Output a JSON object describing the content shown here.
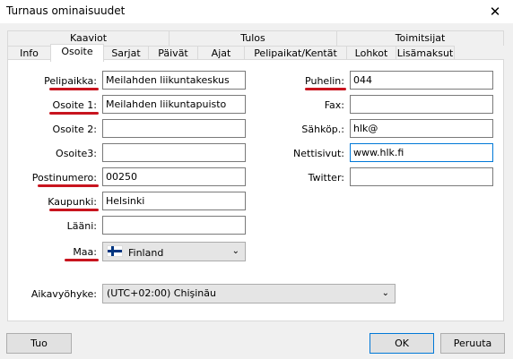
{
  "window": {
    "title": "Turnaus ominaisuudet",
    "close_glyph": "✕"
  },
  "tabs_upper": [
    "Kaaviot",
    "Tulos",
    "Toimitsijat"
  ],
  "tabs_lower": [
    "Info",
    "Osoite",
    "Sarjat",
    "Päivät",
    "Ajat",
    "Pelipaikat/Kentät",
    "Lohkot",
    "Lisämaksut"
  ],
  "active_tab": "Osoite",
  "left_fields": [
    {
      "label": "Pelipaikka:",
      "value": "Meilahden liikuntakeskus",
      "underlined": true
    },
    {
      "label": "Osoite 1:",
      "value": "Meilahden liikuntapuisto",
      "underlined": true
    },
    {
      "label": "Osoite 2:",
      "value": "",
      "underlined": false
    },
    {
      "label": "Osoite3:",
      "value": "",
      "underlined": false
    },
    {
      "label": "Postinumero:",
      "value": "00250",
      "underlined": true
    },
    {
      "label": "Kaupunki:",
      "value": "Helsinki",
      "underlined": true
    },
    {
      "label": "Lääni:",
      "value": "",
      "underlined": false
    }
  ],
  "country": {
    "label": "Maa:",
    "value": "Finland",
    "flag_icon": "finland-flag-icon",
    "underlined": true
  },
  "right_fields": [
    {
      "label": "Puhelin:",
      "value": "044",
      "underlined": true
    },
    {
      "label": "Fax:",
      "value": "",
      "underlined": false
    },
    {
      "label": "Sähköp.:",
      "value": "hlk@",
      "underlined": false
    },
    {
      "label": "Nettisivut:",
      "value": "www.hlk.fi",
      "underlined": false,
      "focused": true
    },
    {
      "label": "Twitter:",
      "value": "",
      "underlined": false
    }
  ],
  "timezone": {
    "label": "Aikavyöhyke:",
    "value": "(UTC+02:00) Chişinău"
  },
  "buttons": {
    "import": "Tuo",
    "ok": "OK",
    "cancel": "Peruuta"
  },
  "colors": {
    "underline": "#c8141e",
    "focus": "#0078d7"
  }
}
